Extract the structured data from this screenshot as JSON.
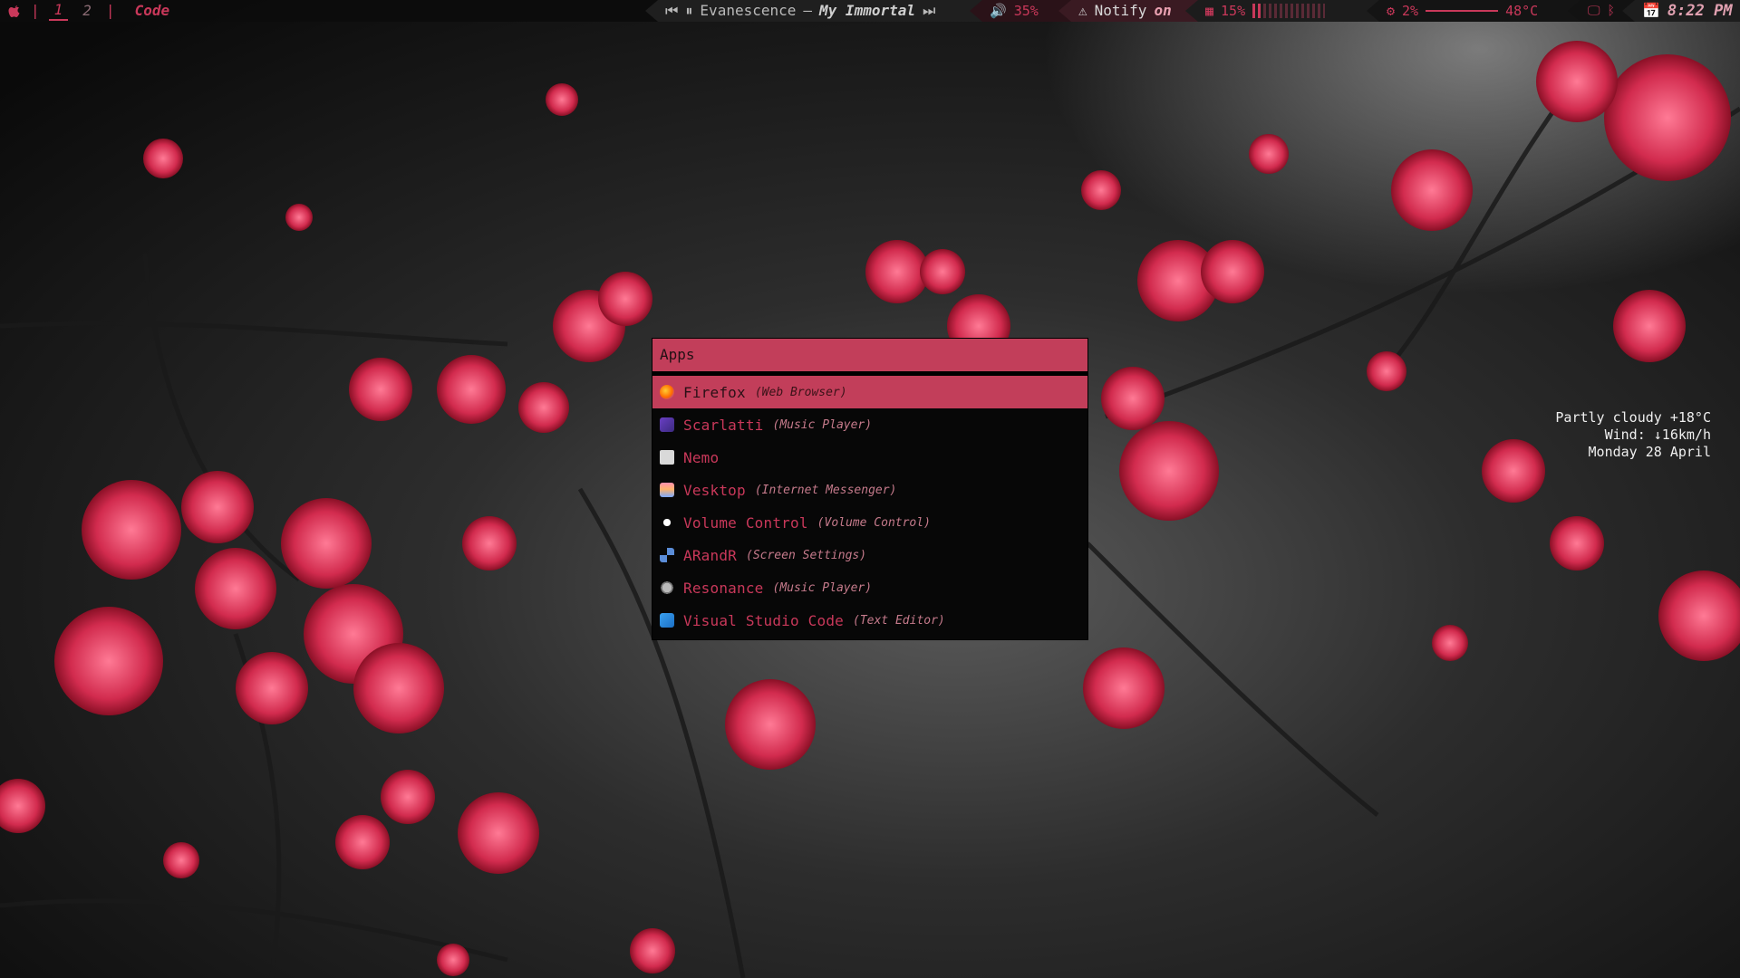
{
  "colors": {
    "accent": "#c23e5a",
    "bar_bg": "#0c0c0c",
    "launcher_bg": "#070707",
    "text_dim": "#c57a8b"
  },
  "topbar": {
    "apple_icon": "apple-icon",
    "sep": "|",
    "workspaces": [
      "1",
      "2"
    ],
    "sep2": "|",
    "window_title": "Code",
    "music": {
      "prev_icon": "skip-back-icon",
      "pause_icon": "pause-icon",
      "artist": "Evanescence",
      "dash": "–",
      "song": "My Immortal",
      "next_icon": "skip-forward-icon"
    },
    "volume": {
      "icon": "speaker-icon",
      "value": "35%"
    },
    "notify": {
      "icon": "warning-icon",
      "label": "Notify",
      "state": "on"
    },
    "memory": {
      "icon": "memory-icon",
      "value": "15%",
      "fraction": 0.15
    },
    "cpu": {
      "icon": "cpu-icon",
      "value": "2%",
      "temp": "48°C"
    },
    "sys_icons": [
      "monitor-icon",
      "bluetooth-icon"
    ],
    "clock": {
      "icon": "calendar-icon",
      "time": "8:22 PM"
    }
  },
  "launcher": {
    "title": "Apps",
    "items": [
      {
        "name": "Firefox",
        "desc": "(Web Browser)",
        "icon": "firefox-icon",
        "selected": true
      },
      {
        "name": "Scarlatti",
        "desc": "(Music Player)",
        "icon": "scarlatti-icon"
      },
      {
        "name": "Nemo",
        "desc": "",
        "icon": "nemo-icon"
      },
      {
        "name": "Vesktop",
        "desc": "(Internet Messenger)",
        "icon": "vesktop-icon"
      },
      {
        "name": "Volume Control",
        "desc": "(Volume Control)",
        "icon": "volume-control-icon"
      },
      {
        "name": "ARandR",
        "desc": "(Screen Settings)",
        "icon": "arandr-icon"
      },
      {
        "name": "Resonance",
        "desc": "(Music Player)",
        "icon": "resonance-icon"
      },
      {
        "name": "Visual Studio Code",
        "desc": "(Text Editor)",
        "icon": "vscode-icon"
      }
    ]
  },
  "weather": {
    "line1": "Partly cloudy +18°C",
    "line2": "Wind: ↓16km/h",
    "line3": "Monday 28 April"
  }
}
